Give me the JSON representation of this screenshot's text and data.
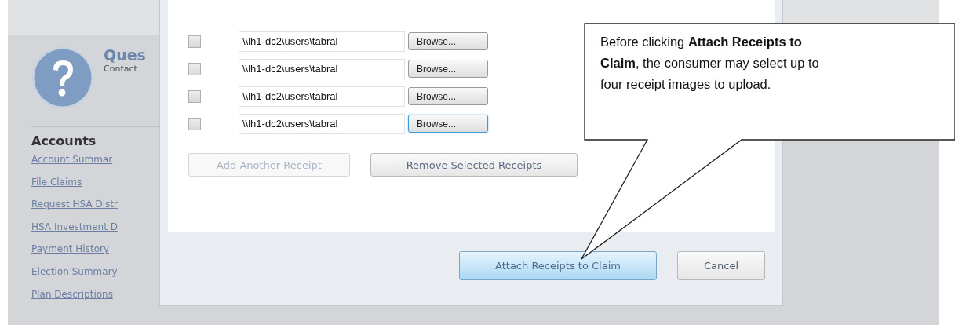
{
  "sidebar": {
    "help_title": "Ques",
    "help_subtitle": "Contact",
    "section_title": "Accounts",
    "links": [
      "Account Summar",
      "File Claims",
      "Request HSA Distr",
      "HSA Investment D",
      "Payment History",
      "Election Summary",
      "Plan Descriptions"
    ]
  },
  "dialog": {
    "receipts": [
      {
        "checked": false,
        "path": "\\\\lh1-dc2\\users\\tabral",
        "browse_label": "Browse...",
        "focused": false
      },
      {
        "checked": false,
        "path": "\\\\lh1-dc2\\users\\tabral",
        "browse_label": "Browse...",
        "focused": false
      },
      {
        "checked": false,
        "path": "\\\\lh1-dc2\\users\\tabral",
        "browse_label": "Browse...",
        "focused": false
      },
      {
        "checked": false,
        "path": "\\\\lh1-dc2\\users\\tabral",
        "browse_label": "Browse...",
        "focused": true
      }
    ],
    "add_button": {
      "label": "Add Another Receipt",
      "disabled": true
    },
    "remove_button": {
      "label": "Remove Selected Receipts",
      "disabled": false
    },
    "attach_button": {
      "label": "Attach Receipts to Claim"
    },
    "cancel_button": {
      "label": "Cancel"
    }
  },
  "callout": {
    "text": "Before clicking **Attach Receipts to Claim**, the consumer may select up to four receipt images to upload."
  }
}
